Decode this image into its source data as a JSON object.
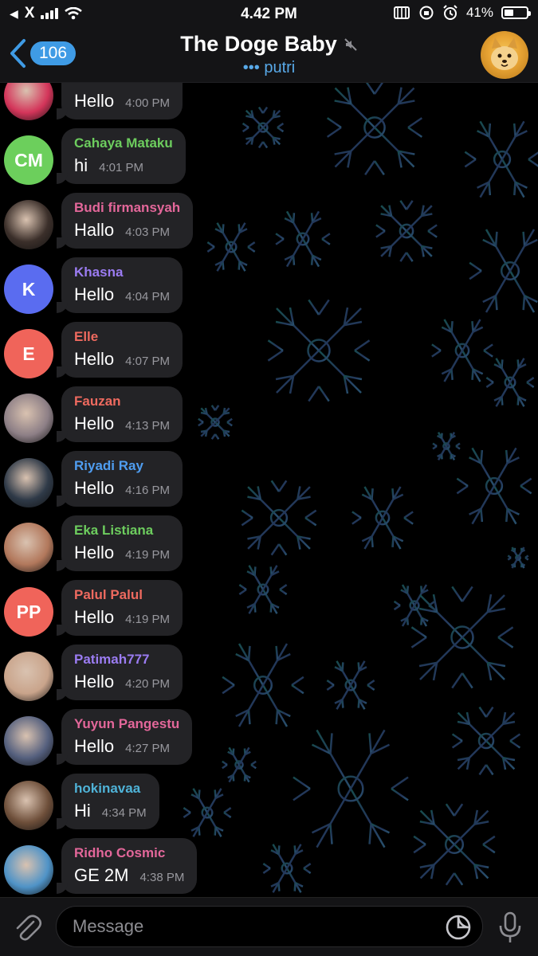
{
  "status_bar": {
    "back_app": "X",
    "time": "4.42 PM",
    "battery_percent": "41%",
    "battery_level": 0.41
  },
  "header": {
    "unread_count": "106",
    "title": "The Doge Baby",
    "typing_user": "putri",
    "muted": true
  },
  "messages": [
    {
      "sender": "",
      "text": "Hello",
      "time": "4:00 PM",
      "avatar_type": "photo",
      "avatar_color": "#d4355a",
      "name_color": "#ffffff"
    },
    {
      "sender": "Cahaya Mataku",
      "text": "hi",
      "time": "4:01 PM",
      "avatar_type": "initials",
      "initials": "CM",
      "avatar_color": "#6ccf5c",
      "name_color": "#6dcd5e"
    },
    {
      "sender": "Budi firmansyah",
      "text": "Hallo",
      "time": "4:03 PM",
      "avatar_type": "photo",
      "avatar_color": "#3b2f2a",
      "name_color": "#e3679a"
    },
    {
      "sender": "Khasna",
      "text": "Hello",
      "time": "4:04 PM",
      "avatar_type": "initials",
      "initials": "K",
      "avatar_color": "#5a6cf0",
      "name_color": "#9b7cf2"
    },
    {
      "sender": "Elle",
      "text": "Hello",
      "time": "4:07 PM",
      "avatar_type": "initials",
      "initials": "E",
      "avatar_color": "#f0645a",
      "name_color": "#ee6a5f"
    },
    {
      "sender": "Fauzan",
      "text": "Hello",
      "time": "4:13 PM",
      "avatar_type": "photo",
      "avatar_color": "#8d7f86",
      "name_color": "#ee6a5f"
    },
    {
      "sender": "Riyadi Ray",
      "text": "Hello",
      "time": "4:16 PM",
      "avatar_type": "photo",
      "avatar_color": "#2f3a48",
      "name_color": "#4f9df0"
    },
    {
      "sender": "Eka Listiana",
      "text": "Hello",
      "time": "4:19 PM",
      "avatar_type": "photo",
      "avatar_color": "#b2785c",
      "name_color": "#6dcd5e"
    },
    {
      "sender": "Palul Palul",
      "text": "Hello",
      "time": "4:19 PM",
      "avatar_type": "initials",
      "initials": "PP",
      "avatar_color": "#f0645a",
      "name_color": "#ee6a5f"
    },
    {
      "sender": "Patimah777",
      "text": "Hello",
      "time": "4:20 PM",
      "avatar_type": "photo",
      "avatar_color": "#c9a48b",
      "name_color": "#9b7cf2"
    },
    {
      "sender": "Yuyun Pangestu",
      "text": "Hello",
      "time": "4:27 PM",
      "avatar_type": "photo",
      "avatar_color": "#55607e",
      "name_color": "#e3679a"
    },
    {
      "sender": "hokinavaa",
      "text": "Hi",
      "time": "4:34 PM",
      "avatar_type": "photo",
      "avatar_color": "#6e4f3a",
      "name_color": "#4fb3d8"
    },
    {
      "sender": "Ridho Cosmic",
      "text": "GE 2M",
      "time": "4:38 PM",
      "avatar_type": "photo",
      "avatar_color": "#4f93c7",
      "name_color": "#e3679a"
    }
  ],
  "composer": {
    "placeholder": "Message"
  },
  "colors": {
    "accent": "#3f9be5",
    "bubble": "#232326",
    "bar": "#141416"
  }
}
